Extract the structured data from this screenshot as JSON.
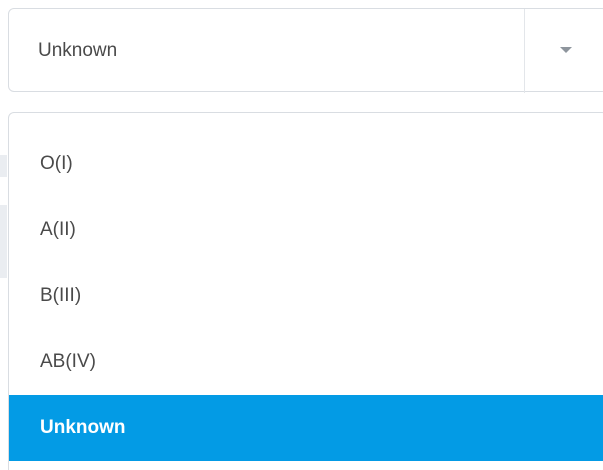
{
  "select": {
    "value": "Unknown"
  },
  "menu": {
    "items": [
      {
        "label": "O(I)"
      },
      {
        "label": "A(II)"
      },
      {
        "label": "B(III)"
      },
      {
        "label": "AB(IV)"
      },
      {
        "label": "Unknown",
        "selected": true
      }
    ]
  },
  "colors": {
    "selected_bg": "#039be5",
    "text": "#4a4a4a",
    "border": "#d9dde2"
  }
}
